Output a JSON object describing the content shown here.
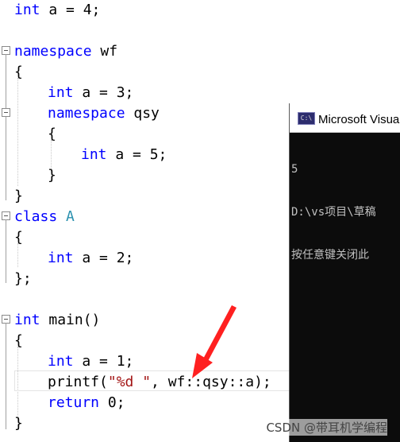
{
  "editor": {
    "lines": [
      {
        "indent": 0,
        "tokens": [
          {
            "c": "kw",
            "t": "int"
          },
          {
            "c": "",
            "t": " a = 4;"
          }
        ]
      },
      {
        "indent": 0,
        "tokens": [
          {
            "c": "kw",
            "t": "namespace"
          },
          {
            "c": "",
            "t": " wf"
          }
        ]
      },
      {
        "indent": 0,
        "tokens": [
          {
            "c": "",
            "t": "{"
          }
        ]
      },
      {
        "indent": 1,
        "tokens": [
          {
            "c": "kw",
            "t": "int"
          },
          {
            "c": "",
            "t": " a = 3;"
          }
        ]
      },
      {
        "indent": 1,
        "tokens": [
          {
            "c": "kw",
            "t": "namespace"
          },
          {
            "c": "",
            "t": " qsy"
          }
        ]
      },
      {
        "indent": 1,
        "tokens": [
          {
            "c": "",
            "t": "{"
          }
        ]
      },
      {
        "indent": 2,
        "tokens": [
          {
            "c": "kw",
            "t": "int"
          },
          {
            "c": "",
            "t": " a = 5;"
          }
        ]
      },
      {
        "indent": 1,
        "tokens": [
          {
            "c": "",
            "t": "}"
          }
        ]
      },
      {
        "indent": 0,
        "tokens": [
          {
            "c": "",
            "t": "}"
          }
        ]
      },
      {
        "indent": 0,
        "tokens": [
          {
            "c": "kw",
            "t": "class"
          },
          {
            "c": "",
            "t": " "
          },
          {
            "c": "ty",
            "t": "A"
          }
        ]
      },
      {
        "indent": 0,
        "tokens": [
          {
            "c": "",
            "t": "{"
          }
        ]
      },
      {
        "indent": 1,
        "tokens": [
          {
            "c": "kw",
            "t": "int"
          },
          {
            "c": "",
            "t": " a = 2;"
          }
        ]
      },
      {
        "indent": 0,
        "tokens": [
          {
            "c": "",
            "t": "};"
          }
        ]
      },
      {
        "indent": 0,
        "tokens": [
          {
            "c": "kw",
            "t": "int"
          },
          {
            "c": "",
            "t": " main()"
          }
        ]
      },
      {
        "indent": 0,
        "tokens": [
          {
            "c": "",
            "t": "{"
          }
        ]
      },
      {
        "indent": 1,
        "tokens": [
          {
            "c": "kw",
            "t": "int"
          },
          {
            "c": "",
            "t": " a = 1;"
          }
        ]
      },
      {
        "indent": 1,
        "tokens": [
          {
            "c": "",
            "t": "printf("
          },
          {
            "c": "st",
            "t": "\"%d \""
          },
          {
            "c": "",
            "t": ", wf::qsy::a);"
          }
        ]
      },
      {
        "indent": 1,
        "tokens": [
          {
            "c": "kw",
            "t": "return"
          },
          {
            "c": "",
            "t": " 0;"
          }
        ]
      },
      {
        "indent": 0,
        "tokens": [
          {
            "c": "",
            "t": "}"
          }
        ]
      }
    ]
  },
  "console": {
    "title": "Microsoft Visual Studio 调试控制台",
    "output_lines": [
      "5",
      "D:\\vs项目\\草稿",
      "按任意键关闭此"
    ]
  },
  "watermark": "CSDN @带耳机学编程",
  "colors": {
    "keyword": "#0000ff",
    "type": "#2b91af",
    "string": "#a31515",
    "arrow": "#ff2020"
  }
}
